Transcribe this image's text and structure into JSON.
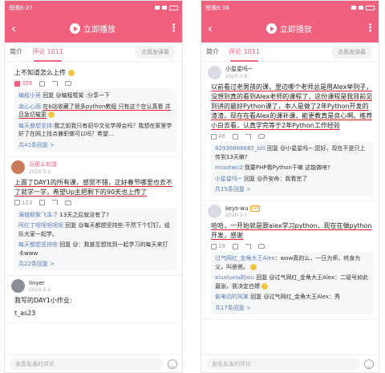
{
  "left": {
    "status": {
      "carrier": "傍晚6:37",
      "right": "◉ ◈ 100%"
    },
    "title": {
      "play_label": "立即播放"
    },
    "tabs": [
      {
        "label": "简介"
      },
      {
        "label": "评论 1011"
      }
    ],
    "danmu_placeholder": "点我发弹幕",
    "top_comment": {
      "text": "上不知道怎么上传",
      "likes": "356"
    },
    "reply_block1": {
      "r1_user": "编程小吴",
      "r1_text": " 回复 @编程框架 :分享一下",
      "r2_user": "余心心雨:",
      "r2_text_a": "在b站收藏了很多python教程 只有这个在认真看 并且急切催更",
      "r3_user": "每天都想坚持:",
      "r3_text": "我之前我只有初中文化学得会吗？我想在家里学好了在网上找点兼职做可以吗？希望...",
      "more": "共41条回复 >"
    },
    "comment2": {
      "user": "没那么和谐",
      "date": "2020-3-2",
      "text": "上面了DAY1的所有课，感觉不错，正好春节哪里也去不了就学一学，希望Up主把剩下的90天也上传了",
      "likes": "123"
    },
    "reply_block2": {
      "r1_user": "满城柳絮飞泽:",
      "r1_text": "？13天之后就没有了?",
      "r2_user": "阿红丁呢呢呢呢呢",
      "r2_text": " 回复 @每天都想坚持些:不然下个钉钉，组队大家一起学。",
      "r3_user": "每天都想坚持些",
      "r3_text": " 回复 @：我甚至想找到一起学习的每天来打卡www",
      "more": "共22条回复 >"
    },
    "comment3": {
      "user": "lInyer",
      "date": "2020-3-2",
      "text": "我写的DAY1小作业:",
      "text2": "t_as23"
    },
    "bottom_placeholder": "发条友善的评论"
  },
  "right": {
    "status": {
      "carrier": "傍晚6:38",
      "right": "◉ ◈ 100%"
    },
    "title": {
      "play_label": "立即播放"
    },
    "tabs": [
      {
        "label": "简介"
      },
      {
        "label": "评论 1011"
      }
    ],
    "danmu_placeholder": "点我发弹幕",
    "comment1": {
      "user": "小星星吗~",
      "date": "2020-3-8",
      "text": "以前看过老男孩的课，里边哪个老师总是用Alex举列子，没想到真的看到Alex老师的课程了，这份课程是我目前见到讲的最好Python课了，本人是做了2年Python开发的渣渣，现在在看Alex的课补课，能更教真是良心啊。推荐小白去看，认真学完等于2年Python工作经验",
      "likes": "48"
    },
    "reply_block1": {
      "r1_user": "82936866685_bili",
      "r1_text": " 回复 @小星星吗~:您好，现在不是只上传到13天嘛?",
      "r2_user": "miaotwo2:",
      "r2_text": "我要PHP看Python干嘛 这能做啥?",
      "r3_user": "小星星吗~",
      "r3_text": " 回复 @乔安命：我看完了",
      "more": "共15条回复 >"
    },
    "comment2": {
      "user": "keys-wu",
      "date": "2020-3-5",
      "text": "哈哈，一开始就是跟alex学习python，现在在做python开发，感谢",
      "likes": "19"
    },
    "reply_block2": {
      "r1_user": "过气网红_金角大王Alex",
      "r1_text": "：wow真的么，一日为师，终身为父，叫爸爸。",
      "r2_user": "xiuxiuxiu的xiu",
      "r2_text": " 回复 @过气网红_金角大王Alex：二级号如此嚣张，我决定白嫖",
      "r3_user": "偷电动的驾某",
      "r3_text": " 回复 @过气网红_金角大王Alex：秀",
      "more": "共17条回复 >"
    },
    "bottom_placeholder": "发条友善的评论"
  }
}
